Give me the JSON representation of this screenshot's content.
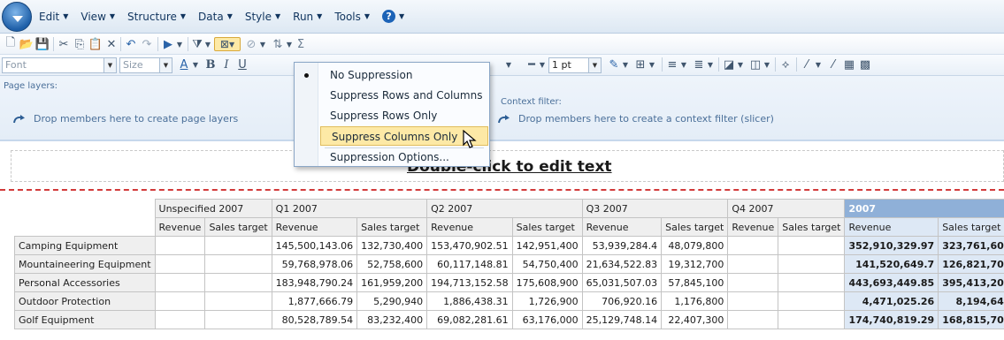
{
  "menubar": {
    "items": [
      "Edit",
      "View",
      "Structure",
      "Data",
      "Style",
      "Run",
      "Tools"
    ]
  },
  "format_bar": {
    "font_placeholder": "Font",
    "size_placeholder": "Size",
    "line_width": "1 pt"
  },
  "drop_zones": {
    "page_layers_title": "Page layers:",
    "page_layers_hint": "Drop members here to create page layers",
    "context_filter_title": "Context filter:",
    "context_filter_hint": "Drop members here to create a context filter (slicer)"
  },
  "textbox": {
    "text": "Double-click to edit text"
  },
  "suppression_menu": {
    "items": [
      {
        "label": "No Suppression",
        "selected": true
      },
      {
        "label": "Suppress Rows and Columns",
        "selected": false
      },
      {
        "label": "Suppress Rows Only",
        "selected": false
      },
      {
        "label": "Suppress Columns Only",
        "selected": false,
        "hovered": true
      },
      {
        "label": "Suppression Options...",
        "selected": false
      }
    ]
  },
  "crosstab": {
    "periods": [
      "Unspecified 2007",
      "Q1 2007",
      "Q2 2007",
      "Q3 2007",
      "Q4 2007",
      "2007"
    ],
    "measures": [
      "Revenue",
      "Sales target"
    ],
    "rows": [
      {
        "label": "Camping Equipment",
        "values": [
          "",
          "",
          "145,500,143.06",
          "132,730,400",
          "153,470,902.51",
          "142,951,400",
          "53,939,284.4",
          "48,079,800",
          "",
          "",
          "352,910,329.97",
          "323,761,600"
        ]
      },
      {
        "label": "Mountaineering Equipment",
        "values": [
          "",
          "",
          "59,768,978.06",
          "52,758,600",
          "60,117,148.81",
          "54,750,400",
          "21,634,522.83",
          "19,312,700",
          "",
          "",
          "141,520,649.7",
          "126,821,700"
        ]
      },
      {
        "label": "Personal Accessories",
        "values": [
          "",
          "",
          "183,948,790.24",
          "161,959,200",
          "194,713,152.58",
          "175,608,900",
          "65,031,507.03",
          "57,845,100",
          "",
          "",
          "443,693,449.85",
          "395,413,200"
        ]
      },
      {
        "label": "Outdoor Protection",
        "values": [
          "",
          "",
          "1,877,666.79",
          "5,290,940",
          "1,886,438.31",
          "1,726,900",
          "706,920.16",
          "1,176,800",
          "",
          "",
          "4,471,025.26",
          "8,194,640"
        ]
      },
      {
        "label": "Golf Equipment",
        "values": [
          "",
          "",
          "80,528,789.54",
          "83,232,400",
          "69,082,281.61",
          "63,176,000",
          "25,129,748.14",
          "22,407,300",
          "",
          "",
          "174,740,819.29",
          "168,815,700"
        ]
      }
    ]
  }
}
